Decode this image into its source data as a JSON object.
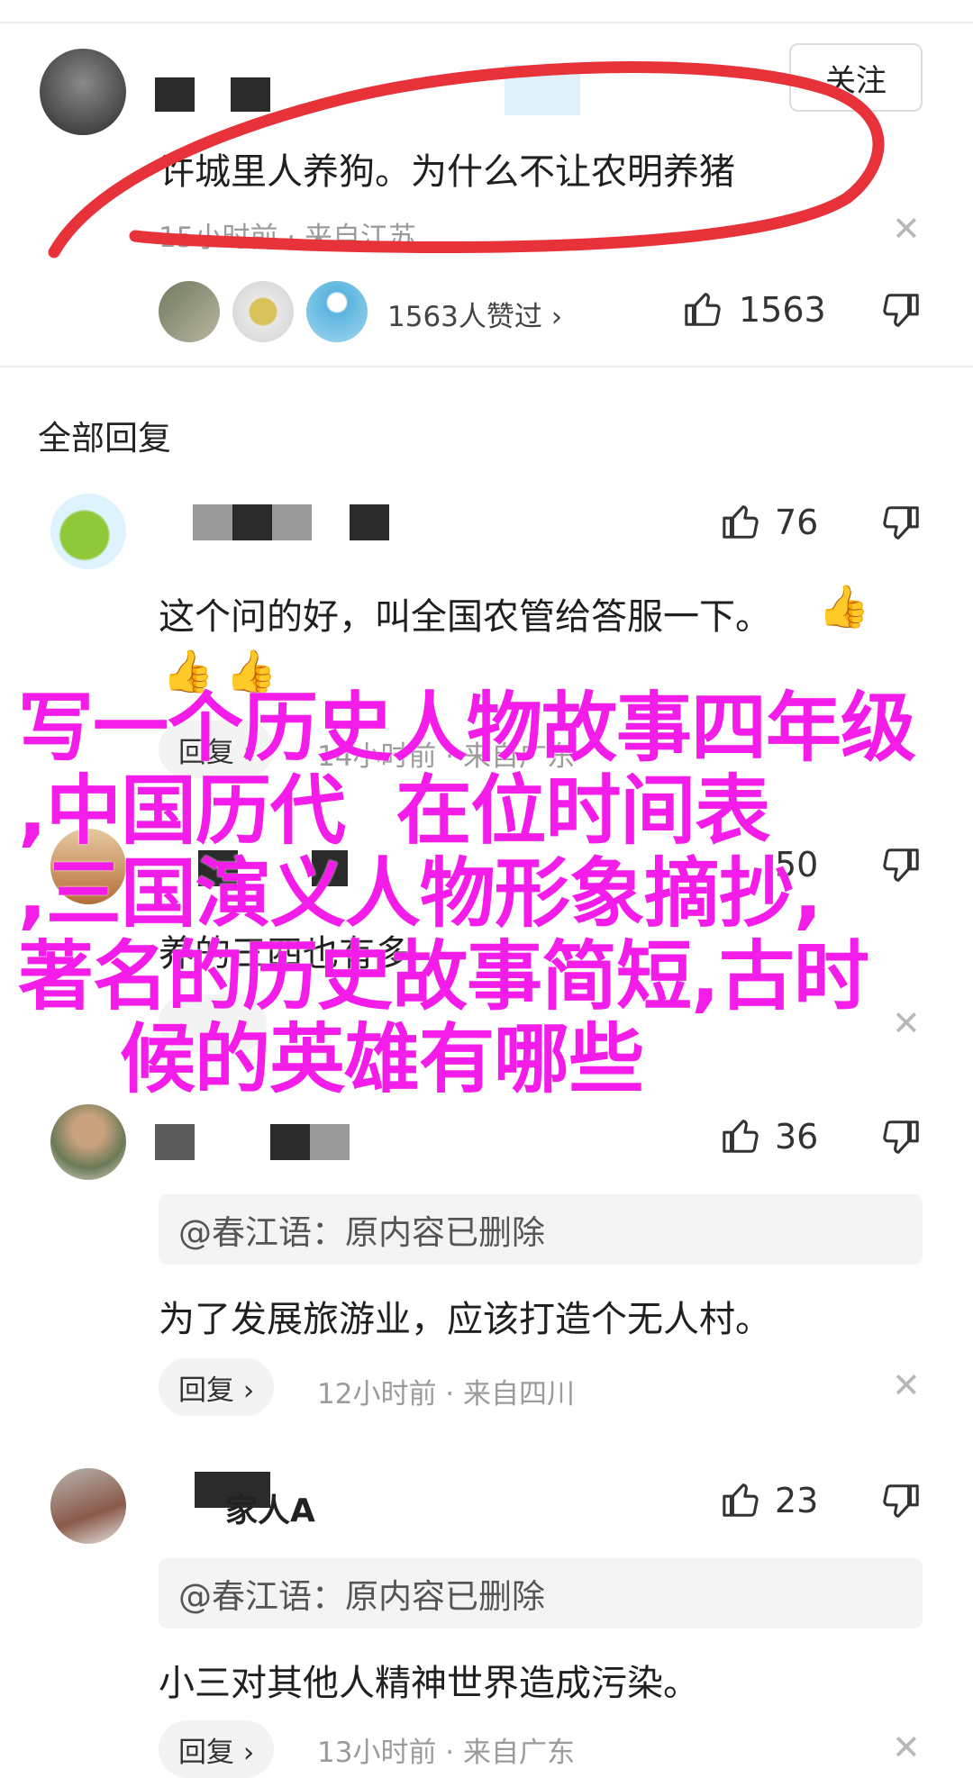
{
  "main_comment": {
    "follow_label": "关注",
    "text": "许城里人养狗。为什么不让农明养猪",
    "meta": "15小时前 · 来自江苏",
    "likers_summary": "1563人赞过 ›",
    "like_count": "1563"
  },
  "replies_section": {
    "title": "全部回复"
  },
  "replies": [
    {
      "like_count": "76",
      "text_line1": "这个问的好，叫全国农管给答服一下。",
      "reply_label": "回复 ›",
      "meta": "14小时前 · 来自广东"
    },
    {
      "like_count": "50",
      "text": "养的三四也有多"
    },
    {
      "like_count": "36",
      "quote": "@春江语：原内容已删除",
      "text": "为了发展旅游业，应该打造个无人村。",
      "reply_label": "回复 ›",
      "meta": "12小时前 · 来自四川"
    },
    {
      "username_visible": "家人A",
      "like_count": "23",
      "quote": "@春江语：原内容已删除",
      "text": "小三对其他人精神世界造成污染。",
      "reply_label": "回复 ›",
      "meta": "13小时前 · 来自广东"
    }
  ],
  "overlay": {
    "text": "写一个历史人物故事四年级\n,中国历代  在位时间表\n,三国演义人物形象摘抄,\n著名的历史故事简短,古时\n    候的英雄有哪些",
    "color": "#f31ce9"
  },
  "colors": {
    "annotation_red": "#e8323a",
    "meta_gray": "#9b9b9b",
    "overlay_magenta": "#f31ce9"
  },
  "icons": [
    "thumbs-up-icon",
    "thumbs-down-icon",
    "close-icon",
    "thumbs-up-emoji"
  ]
}
